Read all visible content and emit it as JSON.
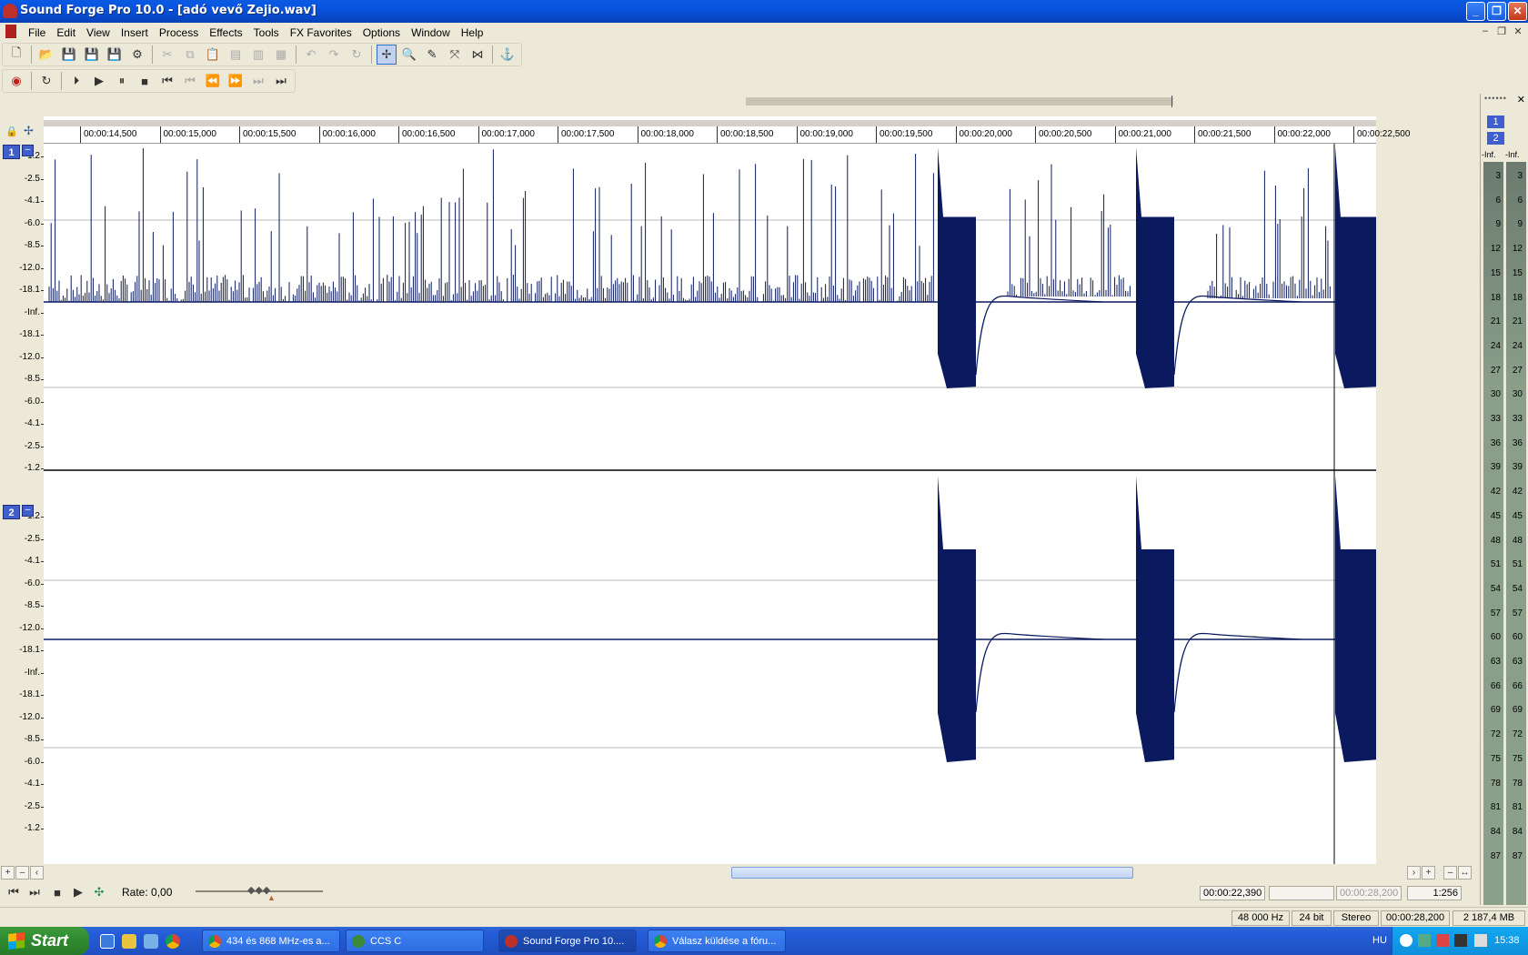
{
  "window": {
    "title": "Sound Forge Pro 10.0 - [adó vevő Zejio.wav]",
    "controls": [
      "minimize",
      "restore",
      "close"
    ]
  },
  "menu": [
    "File",
    "Edit",
    "View",
    "Insert",
    "Process",
    "Effects",
    "Tools",
    "FX Favorites",
    "Options",
    "Window",
    "Help"
  ],
  "ruler": {
    "labels": [
      "00:00:14,500",
      "00:00:15,000",
      "00:00:15,500",
      "00:00:16,000",
      "00:00:16,500",
      "00:00:17,000",
      "00:00:17,500",
      "00:00:18,000",
      "00:00:18,500",
      "00:00:19,000",
      "00:00:19,500",
      "00:00:20,000",
      "00:00:20,500",
      "00:00:21,000",
      "00:00:21,500",
      "00:00:22,000",
      "00:00:22,500"
    ]
  },
  "channels": [
    {
      "id": "1",
      "scale": [
        "-1.2",
        "-2.5",
        "-4.1",
        "-6.0",
        "-8.5",
        "-12.0",
        "-18.1",
        "-Inf.",
        "-18.1",
        "-12.0",
        "-8.5",
        "-6.0",
        "-4.1",
        "-2.5",
        "-1.2"
      ]
    },
    {
      "id": "2",
      "scale": [
        "-1.2",
        "-2.5",
        "-4.1",
        "-6.0",
        "-8.5",
        "-12.0",
        "-18.1",
        "-Inf.",
        "-18.1",
        "-12.0",
        "-8.5",
        "-6.0",
        "-4.1",
        "-2.5",
        "-1.2"
      ]
    }
  ],
  "transport": {
    "rate_label": "Rate: 0,00",
    "cursor_time": "00:00:22,390",
    "selection_blank": "",
    "length_dim": "00:00:28,200",
    "zoom": "1:256"
  },
  "status": {
    "sample_rate": "48 000 Hz",
    "bit_depth": "24 bit",
    "channels": "Stereo",
    "length": "00:00:28,200",
    "size": "2 187,4 MB"
  },
  "meters": {
    "channel_labels": [
      "1",
      "2"
    ],
    "inf_labels": [
      "-Inf.",
      "-Inf."
    ],
    "scale": [
      "3",
      "6",
      "9",
      "12",
      "15",
      "18",
      "21",
      "24",
      "27",
      "30",
      "33",
      "36",
      "39",
      "42",
      "45",
      "48",
      "51",
      "54",
      "57",
      "60",
      "63",
      "66",
      "69",
      "72",
      "75",
      "78",
      "81",
      "84",
      "87"
    ]
  },
  "taskbar": {
    "start_label": "Start",
    "tasks": [
      {
        "label": "434 és 868 MHz-es a...",
        "icon": "chrome-icon",
        "active": false
      },
      {
        "label": "CCS C",
        "icon": "ccs-icon",
        "active": false
      },
      {
        "label": "Sound Forge Pro 10....",
        "icon": "soundforge-icon",
        "active": true
      },
      {
        "label": "Válasz küldése a fóru...",
        "icon": "chrome-icon",
        "active": false
      }
    ],
    "language": "HU",
    "clock": "15:38"
  },
  "colors": {
    "waveform": "#0b1a5e",
    "titlebar": "#0a5ae4",
    "channel_badge": "#3f5fcf"
  }
}
